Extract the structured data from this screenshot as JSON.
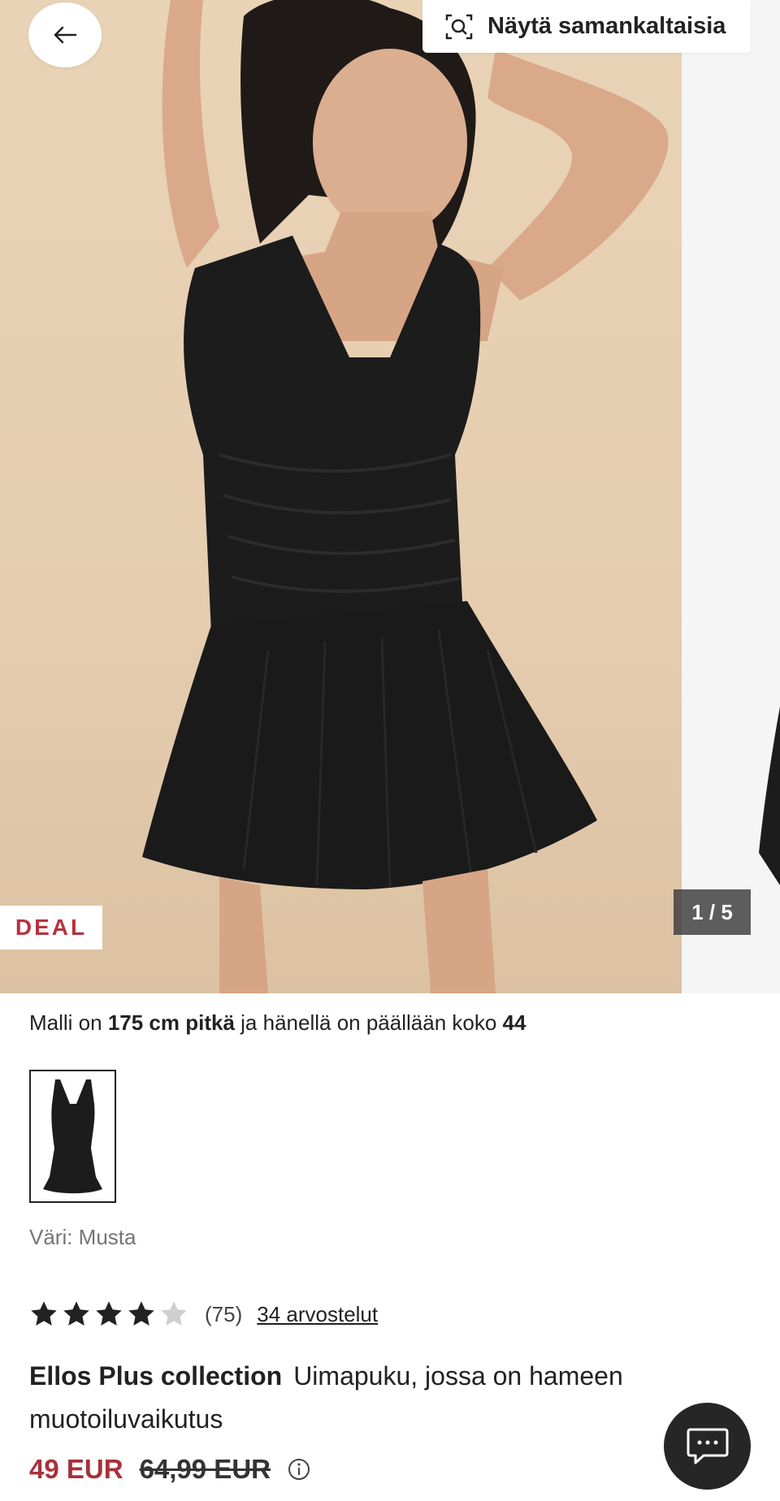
{
  "gallery": {
    "back_icon": "arrow-left-icon",
    "similar_icon": "visual-search-icon",
    "similar_label": "Näytä samankaltaisia",
    "badge": "DEAL",
    "counter": "1 / 5",
    "colors": {
      "background": "#e9d3b6",
      "garment": "#1c1c1c",
      "badge_text": "#b8323f"
    }
  },
  "model_info": {
    "prefix": "Malli on",
    "height": "175 cm pitkä",
    "middle": "ja hänellä on päällään koko",
    "size": "44"
  },
  "color": {
    "label": "Väri: Musta"
  },
  "rating": {
    "score": 4,
    "max": 5,
    "count": "(75)",
    "reviews_link": "34 arvostelut"
  },
  "product": {
    "brand": "Ellos Plus collection",
    "name": "Uimapuku, jossa on hameen muotoiluvaikutus"
  },
  "price": {
    "current": "49 EUR",
    "original": "64,99 EUR",
    "current_color": "#a8303b",
    "info_icon": "info-icon"
  },
  "chat": {
    "icon": "chat-bubble-icon"
  }
}
